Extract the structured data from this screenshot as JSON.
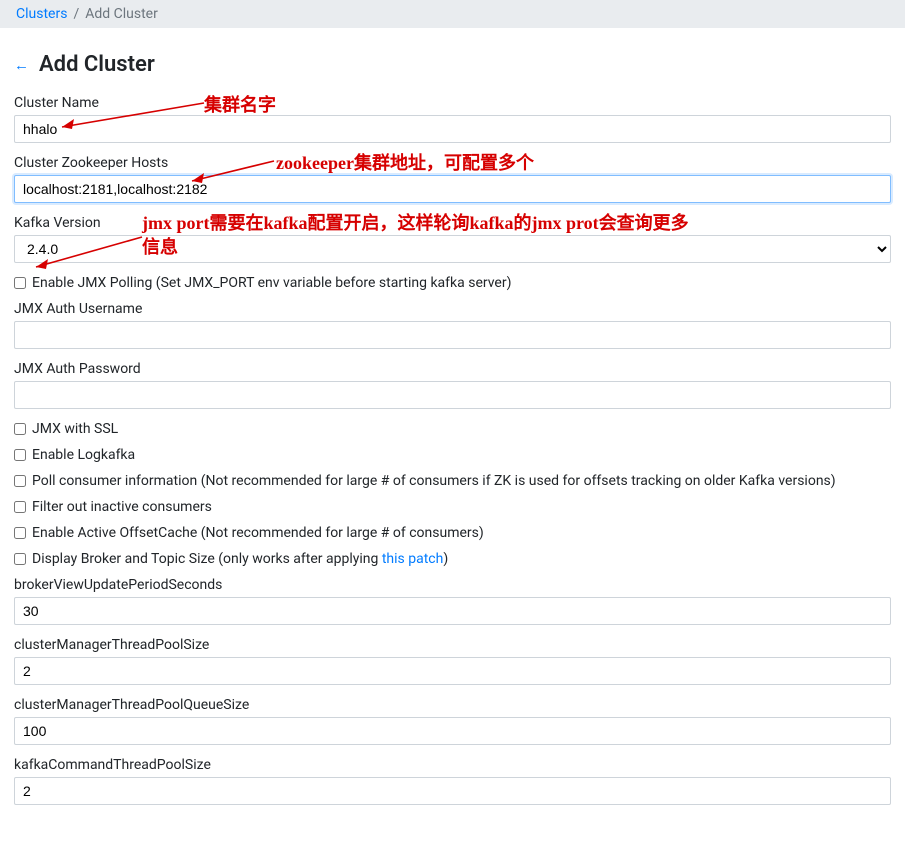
{
  "breadcrumb": {
    "root": "Clusters",
    "current": "Add Cluster"
  },
  "title": "Add Cluster",
  "annotations": {
    "cluster_name": "集群名字",
    "zk_hosts": "zookeeper集群地址，可配置多个",
    "jmx_line1": "jmx port需要在kafka配置开启，这样轮询kafka的jmx prot会查询更多",
    "jmx_line2": "信息"
  },
  "fields": {
    "cluster_name": {
      "label": "Cluster Name",
      "value": "hhalo"
    },
    "zk_hosts": {
      "label": "Cluster Zookeeper Hosts",
      "value": "localhost:2181,localhost:2182"
    },
    "kafka_version": {
      "label": "Kafka Version",
      "value": "2.4.0"
    },
    "jmx_username": {
      "label": "JMX Auth Username",
      "value": ""
    },
    "jmx_password": {
      "label": "JMX Auth Password",
      "value": ""
    },
    "broker_view_update_seconds": {
      "label": "brokerViewUpdatePeriodSeconds",
      "value": "30"
    },
    "cluster_mgr_pool_size": {
      "label": "clusterManagerThreadPoolSize",
      "value": "2"
    },
    "cluster_mgr_pool_queue_size": {
      "label": "clusterManagerThreadPoolQueueSize",
      "value": "100"
    },
    "kafka_cmd_pool_size": {
      "label": "kafkaCommandThreadPoolSize",
      "value": "2"
    }
  },
  "checkboxes": {
    "enable_jmx_polling": "Enable JMX Polling (Set JMX_PORT env variable before starting kafka server)",
    "jmx_with_ssl": "JMX with SSL",
    "enable_logkafka": "Enable Logkafka",
    "poll_consumer_info": "Poll consumer information (Not recommended for large # of consumers if ZK is used for offsets tracking on older Kafka versions)",
    "filter_inactive_consumers": "Filter out inactive consumers",
    "enable_active_offset_cache": "Enable Active OffsetCache (Not recommended for large # of consumers)",
    "display_broker_topic_size_pre": "Display Broker and Topic Size (only works after applying ",
    "display_broker_topic_size_link": "this patch",
    "display_broker_topic_size_post": ")"
  }
}
